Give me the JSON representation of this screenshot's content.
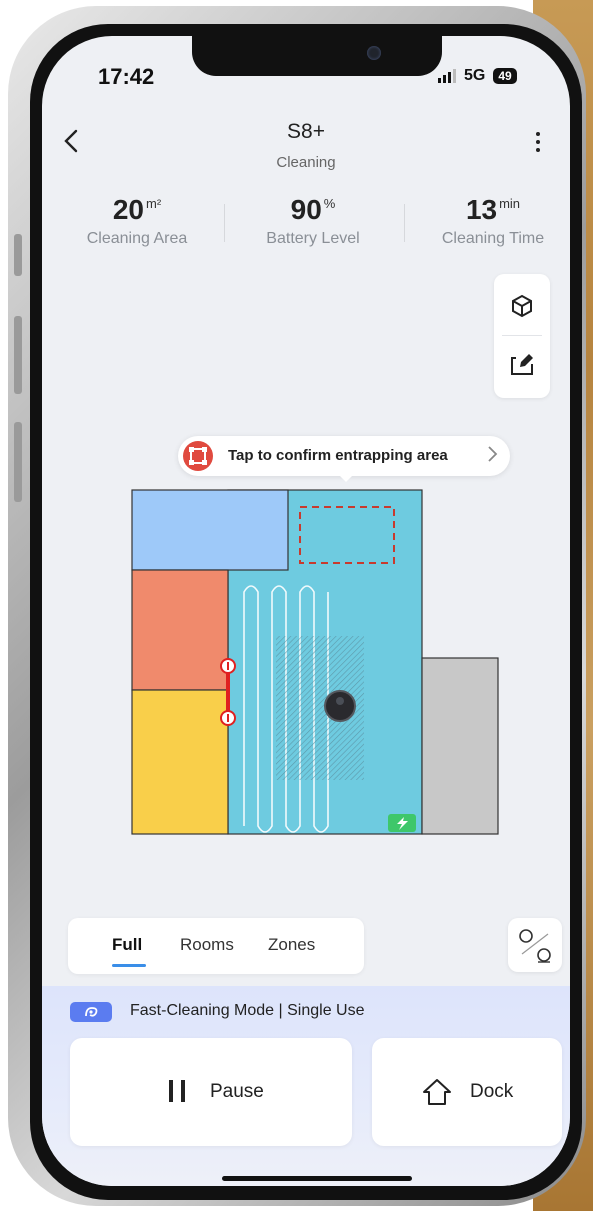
{
  "status_bar": {
    "time": "17:42",
    "network": "5G",
    "battery": "49"
  },
  "header": {
    "title": "S8+",
    "status": "Cleaning"
  },
  "stats": [
    {
      "value": "20",
      "unit": "m²",
      "label": "Cleaning Area"
    },
    {
      "value": "90",
      "unit": "%",
      "label": "Battery Level"
    },
    {
      "value": "13",
      "unit": "min",
      "label": "Cleaning Time"
    }
  ],
  "map_tools": {
    "view_3d_icon": "cube-icon",
    "edit_map_icon": "edit-map-icon"
  },
  "banner": {
    "text": "Tap to confirm entrapping area"
  },
  "map": {
    "room_colors": {
      "top_left": "#9ec9f9",
      "middle_left": "#f08a6c",
      "bottom_left": "#f9cf4a",
      "main": "#6ecbe0",
      "right": "#c8c8c8"
    },
    "entrapping_zone_color": "#c83a2e",
    "robot": "robot-icon",
    "dock": "charging-dock-icon"
  },
  "mode_tabs": [
    {
      "label": "Full",
      "active": true
    },
    {
      "label": "Rooms",
      "active": false
    },
    {
      "label": "Zones",
      "active": false
    }
  ],
  "mode": {
    "text": "Fast-Cleaning Mode | Single Use"
  },
  "actions": {
    "pause": "Pause",
    "dock": "Dock"
  },
  "colors": {
    "accent": "#3a8ee8",
    "mode_badge": "#5b7cf0",
    "alert": "#e04a3f"
  }
}
